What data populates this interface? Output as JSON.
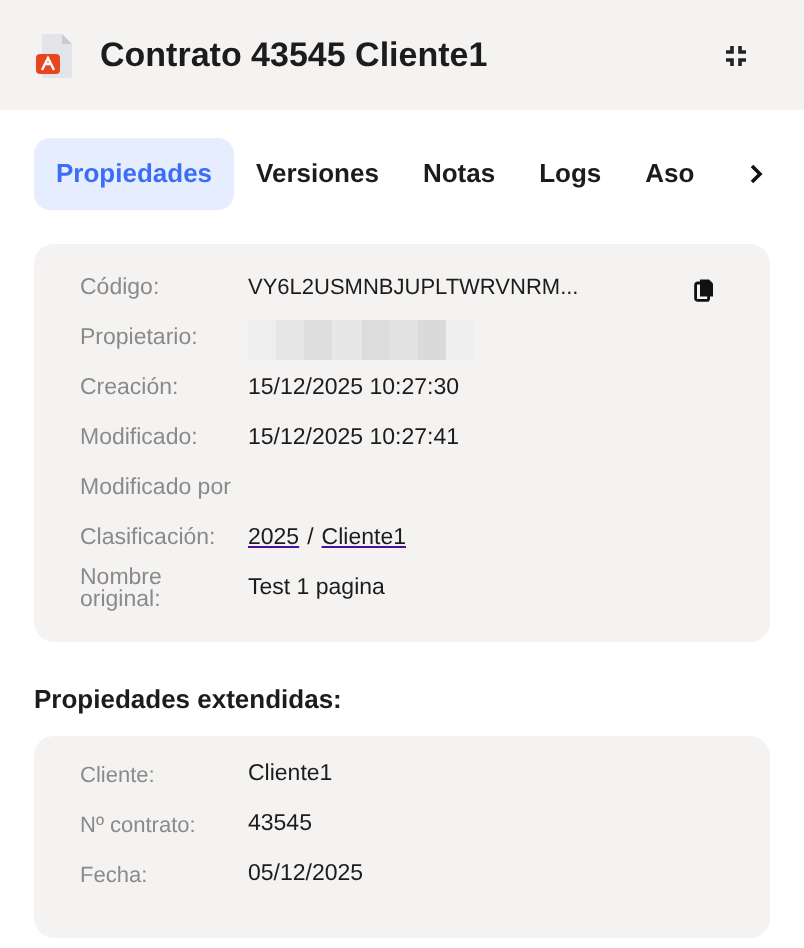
{
  "window": {
    "title": "Contrato 43545 Cliente1"
  },
  "tabs": [
    {
      "label": "Propiedades",
      "selected": true
    },
    {
      "label": "Versiones",
      "selected": false
    },
    {
      "label": "Notas",
      "selected": false
    },
    {
      "label": "Logs",
      "selected": false
    },
    {
      "label": "Aso",
      "selected": false
    }
  ],
  "properties": [
    {
      "label": "Código:",
      "kind": "copy",
      "value": "VY6L2USMNBJUPLTWRVNRM..."
    },
    {
      "label": "Propietario:",
      "kind": "redacted"
    },
    {
      "label": "Creación:",
      "kind": "text",
      "value": "15/12/2025 10:27:30"
    },
    {
      "label": "Modificado:",
      "kind": "text",
      "value": "15/12/2025 10:27:41"
    },
    {
      "label": "Modificado por",
      "kind": "empty"
    },
    {
      "label": "Clasificación:",
      "kind": "links",
      "links": [
        "2025",
        "Cliente1"
      ],
      "separator": "/"
    },
    {
      "label": "Nombre original:",
      "kind": "text",
      "value": "Test 1 pagina"
    }
  ],
  "extended": {
    "title": "Propiedades extendidas:",
    "rows": [
      {
        "label": "Cliente:",
        "value": "Cliente1"
      },
      {
        "label": "Nº contrato:",
        "value": "43545"
      },
      {
        "label": "Fecha:",
        "value": "05/12/2025"
      }
    ]
  }
}
